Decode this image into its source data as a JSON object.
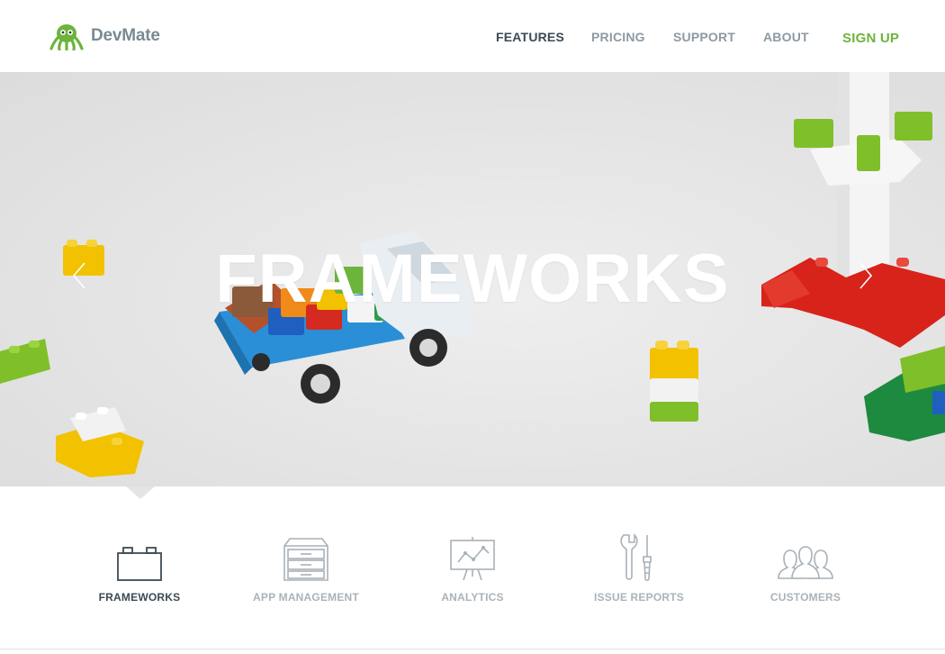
{
  "brand": {
    "name": "DevMate"
  },
  "nav": {
    "items": [
      {
        "label": "FEATURES",
        "active": true
      },
      {
        "label": "PRICING"
      },
      {
        "label": "SUPPORT"
      },
      {
        "label": "ABOUT"
      }
    ],
    "signup": "SIGN UP"
  },
  "hero": {
    "title": "FRAMEWORKS",
    "prev_icon": "chevron-left-icon",
    "next_icon": "chevron-right-icon"
  },
  "features": [
    {
      "label": "FRAMEWORKS",
      "icon": "frameworks-icon",
      "active": true
    },
    {
      "label": "APP MANAGEMENT",
      "icon": "app-management-icon"
    },
    {
      "label": "ANALYTICS",
      "icon": "analytics-icon"
    },
    {
      "label": "ISSUE REPORTS",
      "icon": "issue-reports-icon"
    },
    {
      "label": "CUSTOMERS",
      "icon": "customers-icon"
    }
  ],
  "colors": {
    "accent": "#6cb43c",
    "nav_active": "#3c4a54",
    "nav": "#8d9aa3"
  }
}
